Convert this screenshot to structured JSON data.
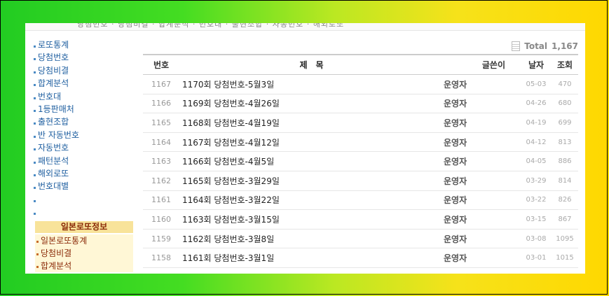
{
  "header": {
    "strip_text": "당첨번호 · 당첨비결 · 합계분석 · 번호대 · 출현조합 · 자동번호 · 해외로또"
  },
  "sidebar": {
    "items": [
      "로또통계",
      "당첨번호",
      "당첨비결",
      "합계분석",
      "번호대",
      "1등판매처",
      "출현조합",
      "반 자동번호",
      "자동번호",
      "패턴분석",
      "해외로또",
      "번호대별",
      "",
      ""
    ],
    "japan_heading": "일본로또정보",
    "japan_items": [
      "일본로또통계",
      "당첨비결",
      "합계분석"
    ]
  },
  "board": {
    "total_label": "Total",
    "total_count": "1,167",
    "columns": {
      "no": "번호",
      "title": "제　목",
      "author": "글쓴이",
      "date": "날자",
      "views": "조회"
    },
    "rows": [
      {
        "no": "1167",
        "title": "1170회 당첨번호-5월3일",
        "author": "운영자",
        "date": "05-03",
        "views": "470"
      },
      {
        "no": "1166",
        "title": "1169회 당첨번호-4월26일",
        "author": "운영자",
        "date": "04-26",
        "views": "680"
      },
      {
        "no": "1165",
        "title": "1168회 당첨번호-4월19일",
        "author": "운영자",
        "date": "04-19",
        "views": "699"
      },
      {
        "no": "1164",
        "title": "1167회 당첨번호-4월12일",
        "author": "운영자",
        "date": "04-12",
        "views": "813"
      },
      {
        "no": "1163",
        "title": "1166회 당첨번호-4월5일",
        "author": "운영자",
        "date": "04-05",
        "views": "886"
      },
      {
        "no": "1162",
        "title": "1165회 당첨번호-3월29일",
        "author": "운영자",
        "date": "03-29",
        "views": "814"
      },
      {
        "no": "1161",
        "title": "1164회 당첨번호-3월22일",
        "author": "운영자",
        "date": "03-22",
        "views": "826"
      },
      {
        "no": "1160",
        "title": "1163회 당첨번호-3월15일",
        "author": "운영자",
        "date": "03-15",
        "views": "867"
      },
      {
        "no": "1159",
        "title": "1162회 당첨번호-3월8일",
        "author": "운영자",
        "date": "03-08",
        "views": "1095"
      },
      {
        "no": "1158",
        "title": "1161회 당첨번호-3월1일",
        "author": "운영자",
        "date": "03-01",
        "views": "1015"
      }
    ]
  },
  "colors": {
    "link": "#1f5fa0",
    "japan_head_bg": "#f8e39a",
    "japan_text": "#8a2a08"
  }
}
